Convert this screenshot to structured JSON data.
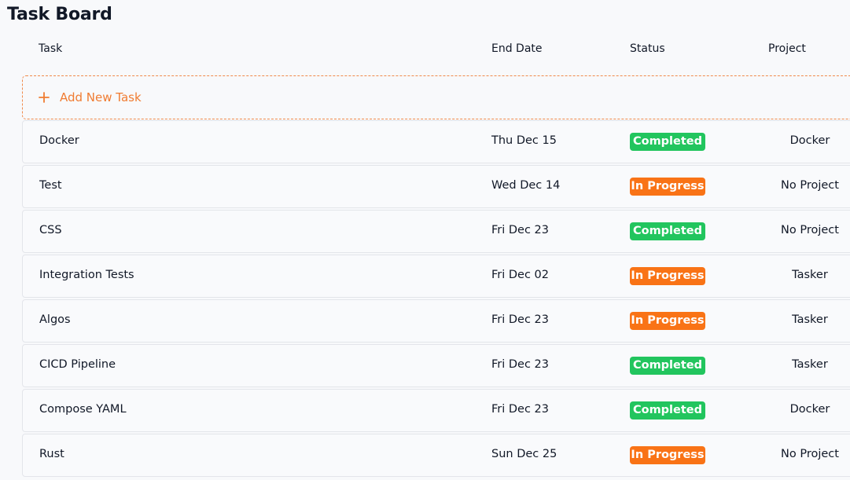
{
  "board": {
    "title": "Task Board"
  },
  "columns": {
    "task": "Task",
    "end_date": "End Date",
    "status": "Status",
    "project": "Project"
  },
  "add_task": {
    "icon": "plus-icon",
    "label": "Add New Task",
    "color": "#f07c32"
  },
  "status_colors": {
    "Completed": "#22c55e",
    "In Progress": "#f97316"
  },
  "tasks": [
    {
      "name": "Docker",
      "end_date": "Thu Dec 15",
      "status": "Completed",
      "project": "Docker"
    },
    {
      "name": "Test",
      "end_date": "Wed Dec 14",
      "status": "In Progress",
      "project": "No Project"
    },
    {
      "name": "CSS",
      "end_date": "Fri Dec 23",
      "status": "Completed",
      "project": "No Project"
    },
    {
      "name": "Integration Tests",
      "end_date": "Fri Dec 02",
      "status": "In Progress",
      "project": "Tasker"
    },
    {
      "name": "Algos",
      "end_date": "Fri Dec 23",
      "status": "In Progress",
      "project": "Tasker"
    },
    {
      "name": "CICD Pipeline",
      "end_date": "Fri Dec 23",
      "status": "Completed",
      "project": "Tasker"
    },
    {
      "name": "Compose YAML",
      "end_date": "Fri Dec 23",
      "status": "Completed",
      "project": "Docker"
    },
    {
      "name": "Rust",
      "end_date": "Sun Dec 25",
      "status": "In Progress",
      "project": "No Project"
    }
  ]
}
